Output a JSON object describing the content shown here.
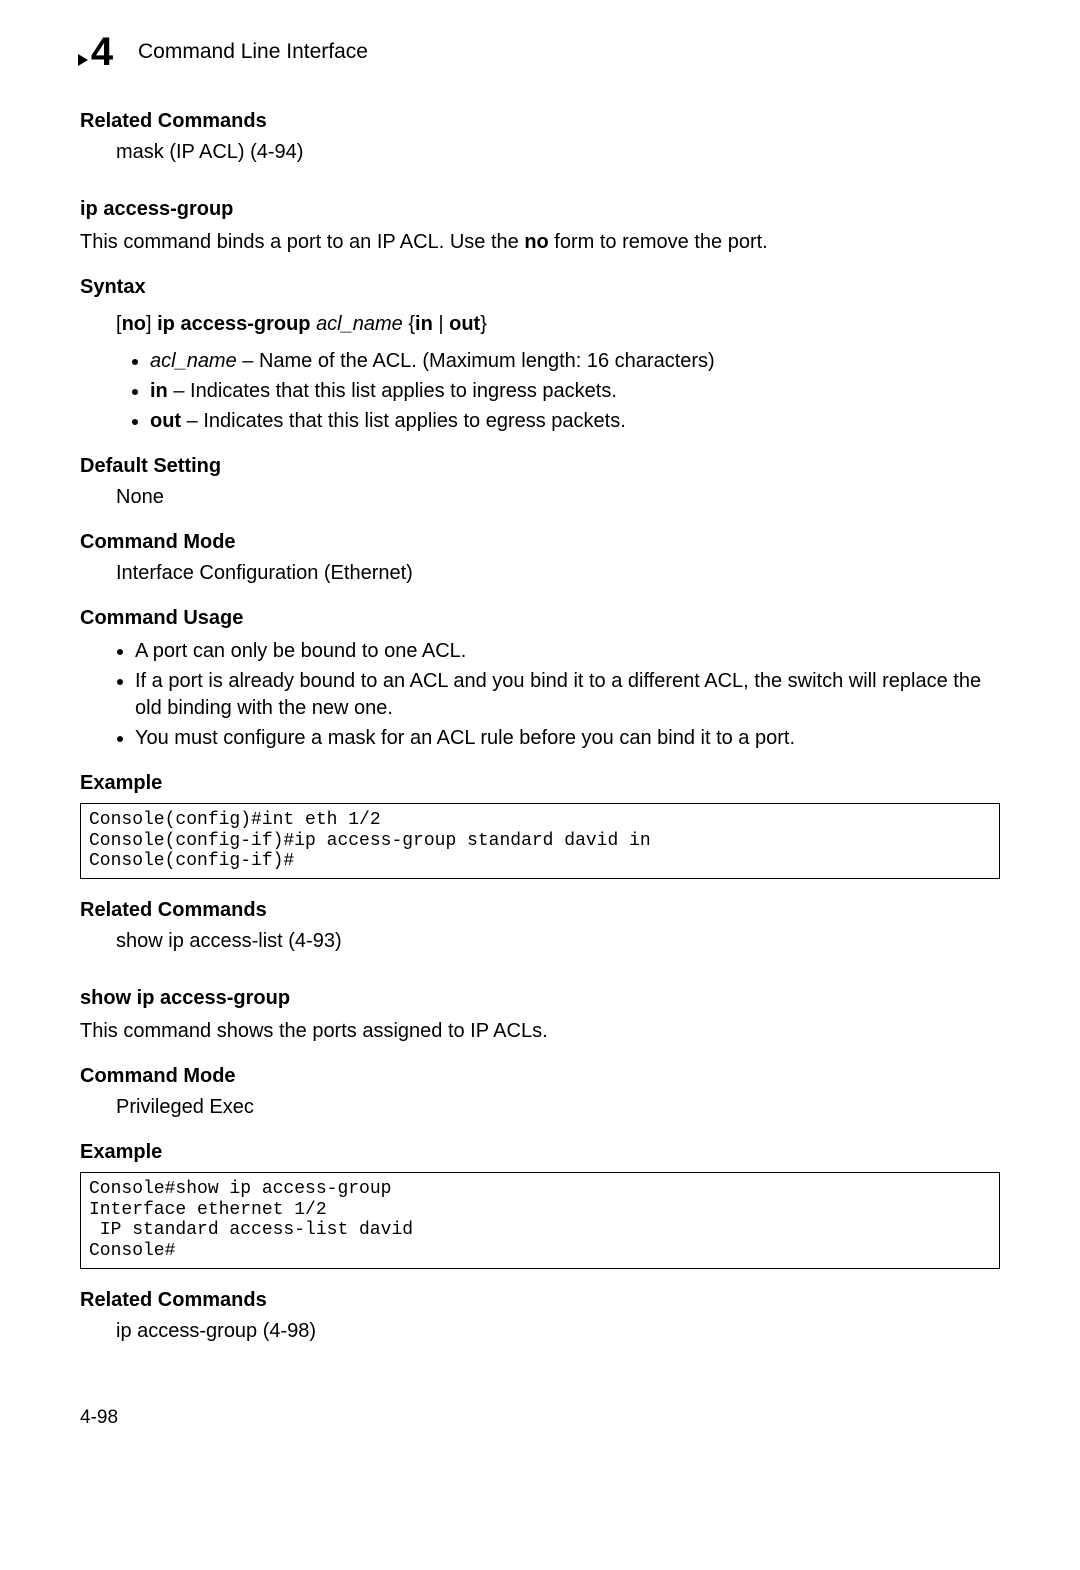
{
  "header": {
    "chapter_number": "4",
    "chapter_title": "Command Line Interface"
  },
  "sections": {
    "related1": {
      "heading": "Related Commands",
      "line": "mask (IP ACL) (4-94)"
    },
    "cmd1": {
      "name": "ip access-group",
      "desc_pre": "This command binds a port to an IP ACL. Use the ",
      "desc_bold": "no",
      "desc_post": " form to remove the port.",
      "syntax_heading": "Syntax",
      "syntax": {
        "lb_no": "[no]",
        "cmd": " ip access-group ",
        "arg": "acl_name",
        "braces": " {",
        "in": "in",
        "pipe": " | ",
        "out": "out",
        "rb": "}"
      },
      "params": {
        "p1_arg": "acl_name",
        "p1_rest": " – Name of the ACL. (Maximum length: 16 characters)",
        "p2_bold": "in",
        "p2_rest": " – Indicates that this list applies to ingress packets.",
        "p3_bold": "out",
        "p3_rest": " – Indicates that this list applies to egress packets."
      },
      "default_heading": "Default Setting",
      "default_value": "None",
      "mode_heading": "Command Mode",
      "mode_value": "Interface Configuration (Ethernet)",
      "usage_heading": "Command Usage",
      "usage": {
        "u1": "A port can only be bound to one ACL.",
        "u2": "If a port is already bound to an ACL and you bind it to a different ACL, the switch will replace the old binding with the new one.",
        "u3": "You must configure a mask for an ACL rule before you can bind it to a port."
      },
      "example_heading": "Example",
      "example_code": "Console(config)#int eth 1/2\nConsole(config-if)#ip access-group standard david in\nConsole(config-if)#",
      "related_heading": "Related Commands",
      "related_line": "show ip access-list (4-93)"
    },
    "cmd2": {
      "name": "show ip access-group",
      "desc": "This command shows the ports assigned to IP ACLs.",
      "mode_heading": "Command Mode",
      "mode_value": "Privileged Exec",
      "example_heading": "Example",
      "example_code": "Console#show ip access-group\nInterface ethernet 1/2\n IP standard access-list david\nConsole#",
      "related_heading": "Related Commands",
      "related_line": "ip access-group (4-98)"
    }
  },
  "pagenum": "4-98"
}
